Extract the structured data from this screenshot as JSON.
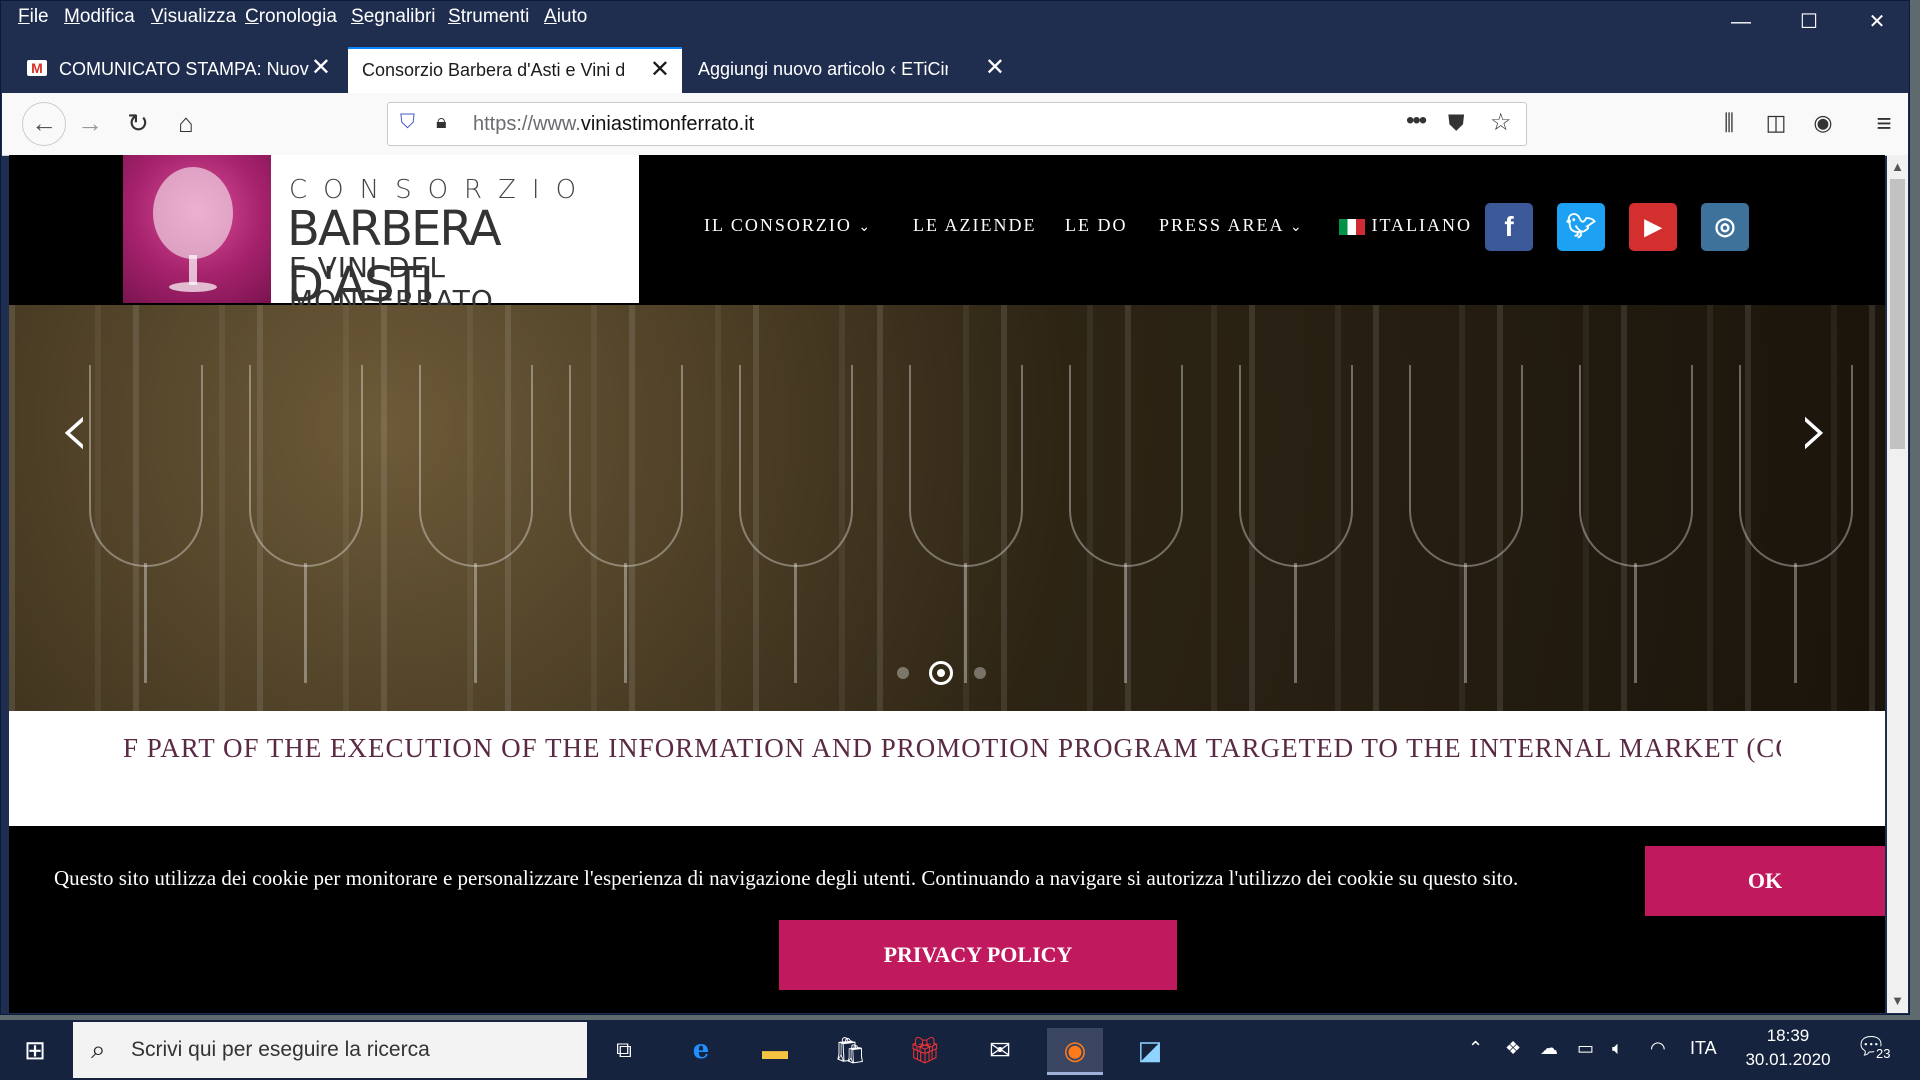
{
  "browser": {
    "menu": [
      "File",
      "Modifica",
      "Visualizza",
      "Cronologia",
      "Segnalibri",
      "Strumenti",
      "Aiuto"
    ],
    "tabs": [
      {
        "title": "COMUNICATO STAMPA: Nuovi",
        "favicon": "gmail-icon"
      },
      {
        "title": "Consorzio Barbera d'Asti e Vini del",
        "favicon": "none"
      },
      {
        "title": "Aggiungi nuovo articolo ‹ ETiCinfor",
        "favicon": "none"
      }
    ],
    "url_prefix": "https://www.",
    "url_domain": "viniastimonferrato.it"
  },
  "site": {
    "logo": {
      "line1": "CONSORZIO",
      "line2": "BARBERA D'ASTI",
      "line3": "E VINI DEL MONFERRATO"
    },
    "nav": [
      "IL CONSORZIO",
      "LE AZIENDE",
      "LE DO",
      "PRESS AREA",
      "ITALIANO"
    ],
    "social": [
      "facebook",
      "twitter",
      "youtube",
      "instagram"
    ],
    "colors": {
      "accent": "#c0195d",
      "facebook": "#3b5998",
      "twitter": "#1da1f2",
      "youtube": "#d32f2f",
      "instagram": "#3f729b"
    },
    "ticker": "F PART OF THE EXECUTION OF THE INFORMATION AND PROMOTION PROGRAM TARGETED TO THE INTERNAL MARKET (COF"
  },
  "cookie": {
    "text": "Questo sito utilizza dei cookie per monitorare e personalizzare l'esperienza di navigazione degli utenti. Continuando a navigare si autorizza l'utilizzo dei cookie su questo sito.",
    "ok": "OK",
    "privacy": "PRIVACY POLICY"
  },
  "taskbar": {
    "search_placeholder": "Scrivi qui per eseguire la ricerca",
    "lang": "ITA",
    "time": "18:39",
    "date": "30.01.2020",
    "notifications": "23"
  }
}
